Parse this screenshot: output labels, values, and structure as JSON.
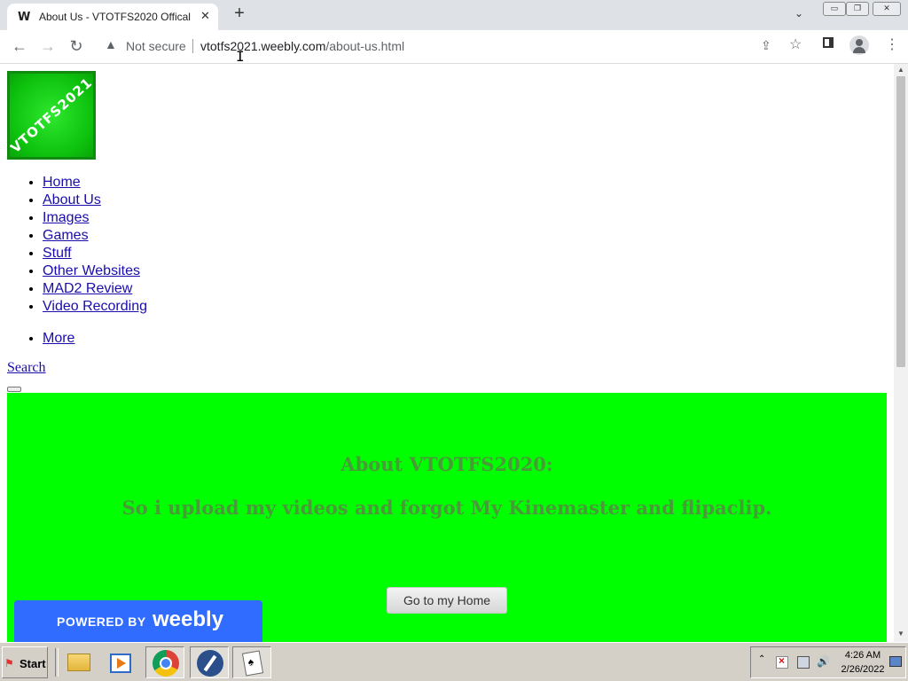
{
  "browser": {
    "tab_favicon": "W",
    "tab_title": "About Us - VTOTFS2020 Offical",
    "tab_close": "✕",
    "new_tab": "+",
    "tab_search": "⌄",
    "window_controls": {
      "minimize": "▭",
      "restore": "❐",
      "close": "✕"
    },
    "security_label": "Not secure",
    "url_host": "vtotfs2021.weebly.com",
    "url_path": "/about-us.html",
    "icons": [
      "back-icon",
      "forward-icon",
      "reload-icon",
      "warning-icon",
      "share-icon",
      "star-icon",
      "side-panel-icon",
      "profile-icon",
      "menu-icon"
    ]
  },
  "page": {
    "logo_text": "VTOTFS2021",
    "nav_items": [
      "Home",
      "About Us",
      "Images",
      "Games",
      "Stuff",
      "Other Websites",
      "MAD2 Review",
      "Video Recording"
    ],
    "more_label": "More",
    "search_label": "Search",
    "banner": {
      "heading": "About VTOTFS2020:",
      "subheading": "So i upload my videos and forgot My Kinemaster and flipaclip.",
      "button_label": "Go to my Home",
      "background": "#00ff00"
    },
    "badge": {
      "prefix": "POWERED BY",
      "brand": "weebly",
      "color": "#2f6cff"
    }
  },
  "taskbar": {
    "start_label": "Start",
    "apps": [
      "file-explorer-icon",
      "media-player-icon",
      "chrome-icon",
      "app-icon",
      "solitaire-icon"
    ],
    "time": "4:26 AM",
    "date": "2/26/2022"
  }
}
